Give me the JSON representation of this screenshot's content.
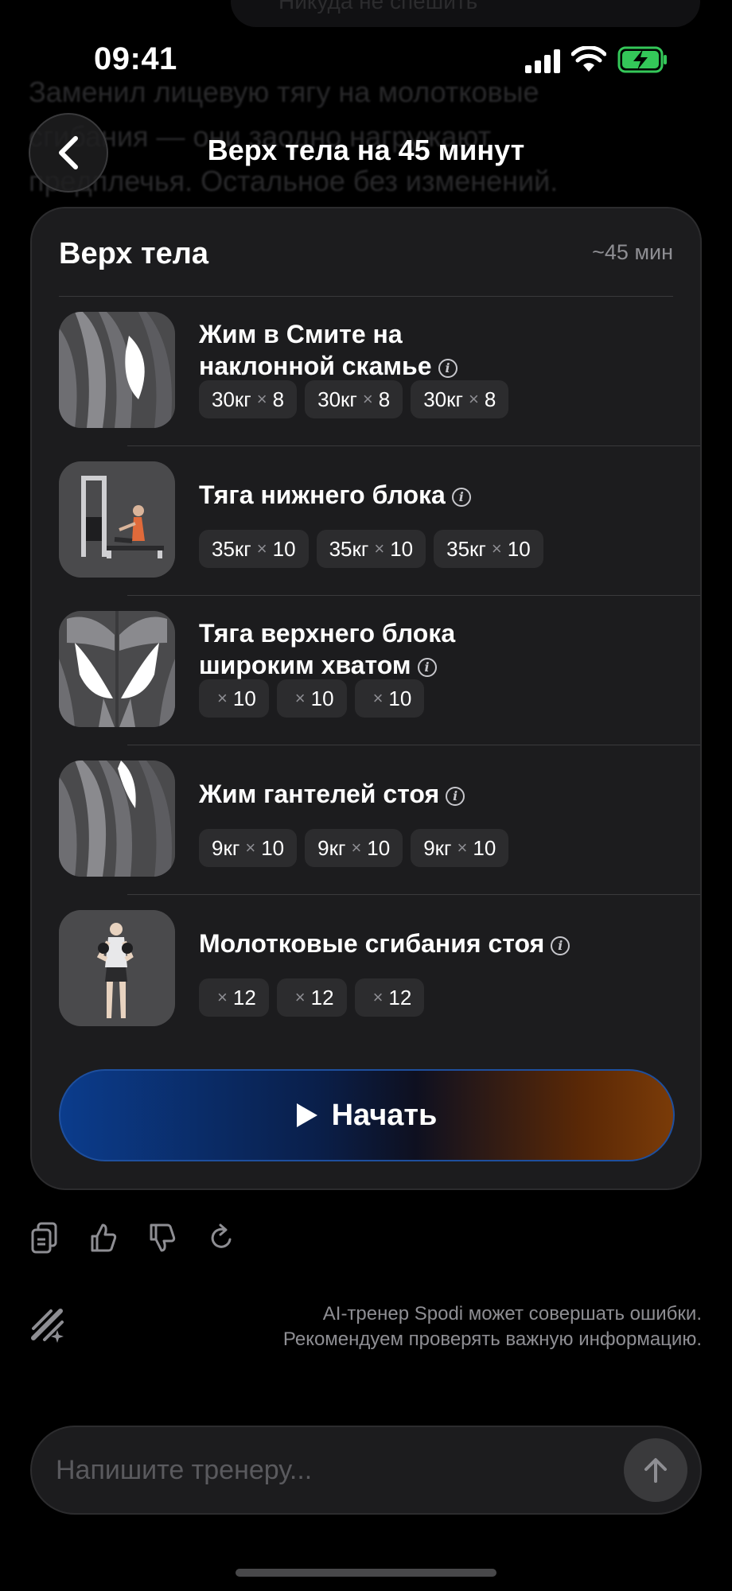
{
  "background_chat": {
    "bubble_text": "Никуда не спешить",
    "message_text": "Заменил лицевую тягу на молотковые сгибания — они заодно нагружают предплечья. Остальное без изменений."
  },
  "status_bar": {
    "time": "09:41",
    "battery_color": "#34c759"
  },
  "header": {
    "title": "Верх тела на 45 минут",
    "back_icon": "chevron-left-icon"
  },
  "workout": {
    "title": "Верх тела",
    "duration": "~45 мин",
    "exercises": [
      {
        "name": "Жим в Смите на наклонной скамье",
        "name_line1": "Жим в Смите на",
        "name_line2": "наклонной скамье",
        "thumbnail": "triceps-muscle-icon",
        "sets": [
          {
            "weight": "30кг",
            "reps": "8"
          },
          {
            "weight": "30кг",
            "reps": "8"
          },
          {
            "weight": "30кг",
            "reps": "8"
          }
        ]
      },
      {
        "name": "Тяга нижнего блока",
        "thumbnail": "cable-row-machine-icon",
        "sets": [
          {
            "weight": "35кг",
            "reps": "10"
          },
          {
            "weight": "35кг",
            "reps": "10"
          },
          {
            "weight": "35кг",
            "reps": "10"
          }
        ]
      },
      {
        "name": "Тяга верхнего блока широким хватом",
        "name_line1": "Тяга верхнего блока",
        "name_line2": "широким хватом",
        "thumbnail": "back-muscle-icon",
        "sets": [
          {
            "weight": "",
            "reps": "10"
          },
          {
            "weight": "",
            "reps": "10"
          },
          {
            "weight": "",
            "reps": "10"
          }
        ]
      },
      {
        "name": "Жим гантелей стоя",
        "thumbnail": "triceps-muscle-icon",
        "sets": [
          {
            "weight": "9кг",
            "reps": "10"
          },
          {
            "weight": "9кг",
            "reps": "10"
          },
          {
            "weight": "9кг",
            "reps": "10"
          }
        ]
      },
      {
        "name": "Молотковые сгибания стоя",
        "thumbnail": "hammer-curl-figure-icon",
        "sets": [
          {
            "weight": "",
            "reps": "12"
          },
          {
            "weight": "",
            "reps": "12"
          },
          {
            "weight": "",
            "reps": "12"
          }
        ]
      }
    ],
    "start_label": "Начать",
    "start_gradient": [
      "#0b3c8c",
      "#7a3b08"
    ]
  },
  "message_actions": [
    "copy-icon",
    "thumbs-up-icon",
    "thumbs-down-icon",
    "regenerate-icon"
  ],
  "disclaimer": {
    "line1": "AI-тренер Spodi может совершать ошибки.",
    "line2": "Рекомендуем проверять важную информацию."
  },
  "composer": {
    "placeholder": "Напишите тренеру..."
  }
}
